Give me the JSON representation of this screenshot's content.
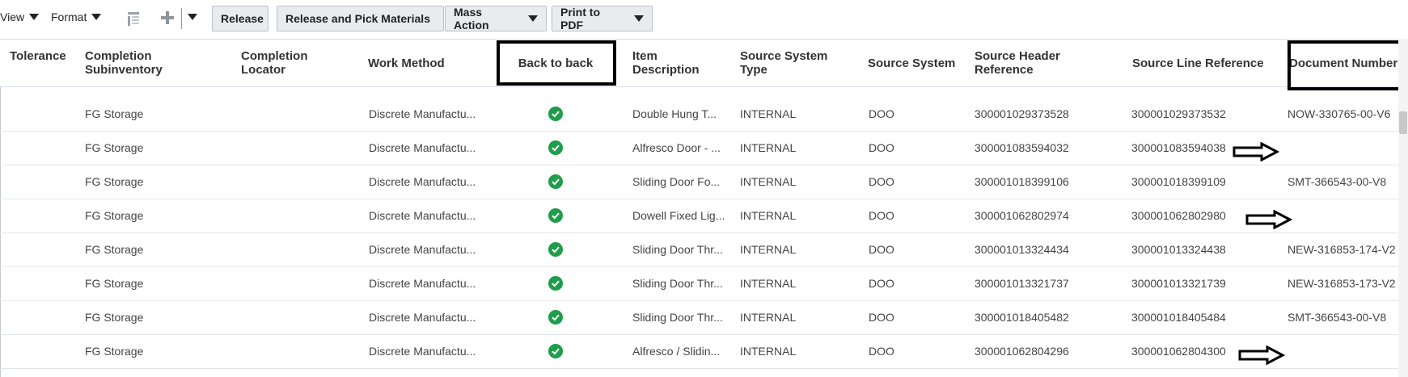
{
  "toolbar": {
    "view_label": "View",
    "format_label": "Format",
    "release_label": "Release",
    "release_pick_label": "Release and Pick Materials",
    "mass_action_label": "Mass Action",
    "print_pdf_label": "Print to PDF"
  },
  "columns": {
    "tolerance": "Tolerance",
    "completion_subinventory": "Completion Subinventory",
    "completion_locator": "Completion Locator",
    "work_method": "Work Method",
    "back_to_back": "Back to back",
    "item_description": "Item Description",
    "source_system_type": "Source System Type",
    "source_system": "Source System",
    "source_header_reference": "Source Header Reference",
    "source_line_reference": "Source Line Reference",
    "document_number": "Document Number"
  },
  "rows": [
    {
      "subinventory": "FG Storage",
      "work_method": "Discrete Manufactu...",
      "item": "Double Hung T...",
      "sys_type": "INTERNAL",
      "system": "DOO",
      "header_ref": "300001029373528",
      "line_ref": "300001029373532",
      "doc": "NOW-330765-00-V6"
    },
    {
      "subinventory": "FG Storage",
      "work_method": "Discrete Manufactu...",
      "item": "Alfresco Door - ...",
      "sys_type": "INTERNAL",
      "system": "DOO",
      "header_ref": "300001083594032",
      "line_ref": "300001083594038",
      "doc": ""
    },
    {
      "subinventory": "FG Storage",
      "work_method": "Discrete Manufactu...",
      "item": "Sliding Door Fo...",
      "sys_type": "INTERNAL",
      "system": "DOO",
      "header_ref": "300001018399106",
      "line_ref": "300001018399109",
      "doc": "SMT-366543-00-V8"
    },
    {
      "subinventory": "FG Storage",
      "work_method": "Discrete Manufactu...",
      "item": "Dowell Fixed Lig...",
      "sys_type": "INTERNAL",
      "system": "DOO",
      "header_ref": "300001062802974",
      "line_ref": "300001062802980",
      "doc": ""
    },
    {
      "subinventory": "FG Storage",
      "work_method": "Discrete Manufactu...",
      "item": "Sliding Door Thr...",
      "sys_type": "INTERNAL",
      "system": "DOO",
      "header_ref": "300001013324434",
      "line_ref": "300001013324438",
      "doc": "NEW-316853-174-V2"
    },
    {
      "subinventory": "FG Storage",
      "work_method": "Discrete Manufactu...",
      "item": "Sliding Door Thr...",
      "sys_type": "INTERNAL",
      "system": "DOO",
      "header_ref": "300001013321737",
      "line_ref": "300001013321739",
      "doc": "NEW-316853-173-V2"
    },
    {
      "subinventory": "FG Storage",
      "work_method": "Discrete Manufactu...",
      "item": "Sliding Door Thr...",
      "sys_type": "INTERNAL",
      "system": "DOO",
      "header_ref": "300001018405482",
      "line_ref": "300001018405484",
      "doc": "SMT-366543-00-V8"
    },
    {
      "subinventory": "FG Storage",
      "work_method": "Discrete Manufactu...",
      "item": "Alfresco / Slidin...",
      "sys_type": "INTERNAL",
      "system": "DOO",
      "header_ref": "300001062804296",
      "line_ref": "300001062804300",
      "doc": ""
    }
  ],
  "icons": {
    "row_status": "check-circle-icon",
    "annotation": "arrow-right-icon"
  },
  "colors": {
    "check_green": "#1e9e4a",
    "button_bg": "#e9ecef"
  }
}
